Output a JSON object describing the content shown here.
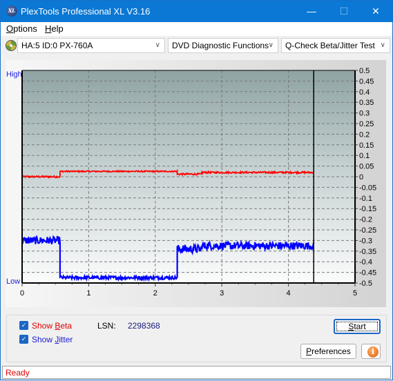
{
  "window": {
    "title": "PlexTools Professional XL V3.16",
    "app_icon": "XL",
    "minimize_icon": "minimize-icon",
    "maximize_icon": "maximize-icon",
    "close_icon": "close-icon"
  },
  "menu": {
    "items": [
      {
        "label": "Options",
        "accel": "O"
      },
      {
        "label": "Help",
        "accel": "H"
      }
    ]
  },
  "toolbar": {
    "drive_select": "HA:5 ID:0  PX-760A",
    "function_select": "DVD Diagnostic Functions",
    "test_select": "Q-Check Beta/Jitter Test"
  },
  "chart_labels": {
    "high": "High",
    "low": "Low"
  },
  "chart_data": {
    "type": "line",
    "title": "",
    "xlabel": "",
    "ylabel": "",
    "xlim": [
      0,
      5
    ],
    "ylim": [
      -0.5,
      0.5
    ],
    "x_ticks": [
      "0",
      "1",
      "2",
      "3",
      "4",
      "5"
    ],
    "y_ticks": [
      "0.5",
      "0.45",
      "0.4",
      "0.35",
      "0.3",
      "0.25",
      "0.2",
      "0.15",
      "0.1",
      "0.05",
      "0",
      "-0.05",
      "-0.1",
      "-0.15",
      "-0.2",
      "-0.25",
      "-0.3",
      "-0.35",
      "-0.4",
      "-0.45",
      "-0.5"
    ],
    "grid": true,
    "end_marker_x": 4.38,
    "series": [
      {
        "name": "Beta",
        "color": "#ff0000",
        "segments": [
          {
            "x0": 0.0,
            "x1": 0.57,
            "y": 0.0,
            "noise": 0.004
          },
          {
            "x0": 0.57,
            "x1": 2.33,
            "y": 0.025,
            "noise": 0.003
          },
          {
            "x0": 2.33,
            "x1": 2.7,
            "y": 0.012,
            "noise": 0.004
          },
          {
            "x0": 2.7,
            "x1": 4.38,
            "y": 0.02,
            "noise": 0.004
          }
        ]
      },
      {
        "name": "Jitter",
        "color": "#0000ff",
        "segments": [
          {
            "x0": 0.0,
            "x1": 0.57,
            "y": -0.3,
            "noise": 0.018
          },
          {
            "x0": 0.57,
            "x1": 2.33,
            "y": -0.475,
            "noise": 0.008
          },
          {
            "x0": 2.33,
            "x1": 2.7,
            "y": -0.34,
            "noise": 0.02
          },
          {
            "x0": 2.7,
            "x1": 4.38,
            "y": -0.325,
            "noise": 0.018
          }
        ]
      }
    ]
  },
  "controls": {
    "show_beta": {
      "label": "Show Beta",
      "checked": true,
      "color": "#e00000"
    },
    "show_jitter": {
      "label": "Show Jitter",
      "checked": true,
      "color": "#1a1ad0"
    },
    "lsn_label": "LSN:",
    "lsn_value": "2298368",
    "start_button": "Start",
    "preferences_button": "Preferences",
    "info_button": "i"
  },
  "status": {
    "text": "Ready"
  }
}
